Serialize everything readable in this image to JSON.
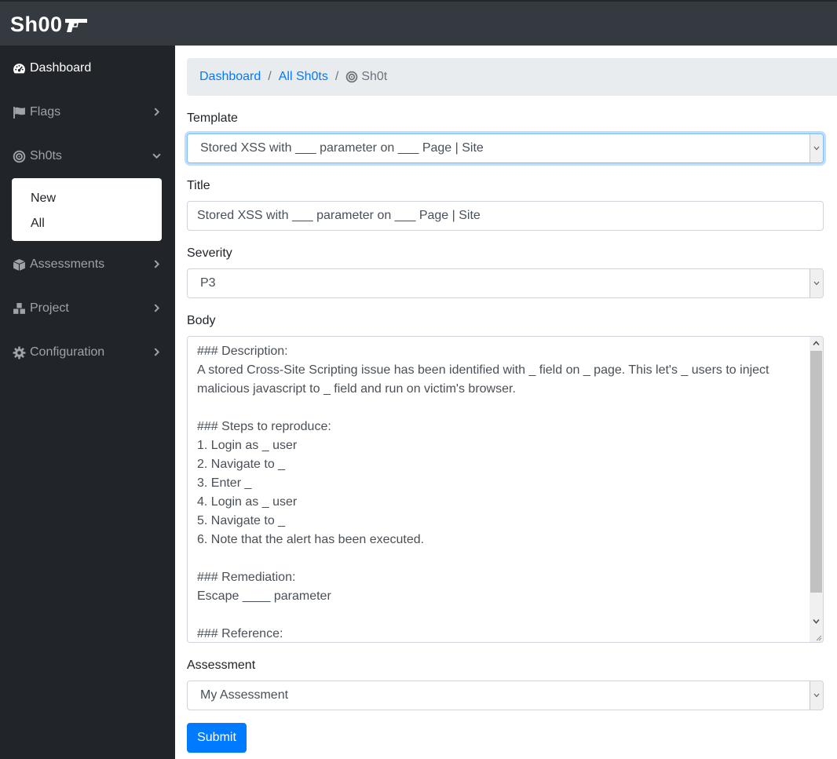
{
  "brand": {
    "name": "Sh00",
    "logo_icon": "gun-icon"
  },
  "sidebar": {
    "items": [
      {
        "label": "Dashboard",
        "icon": "tachometer-icon",
        "active": true
      },
      {
        "label": "Flags",
        "icon": "flag-icon",
        "chevron": "right"
      },
      {
        "label": "Sh0ts",
        "icon": "bullseye-icon",
        "chevron": "down"
      },
      {
        "label": "Assessments",
        "icon": "cube-icon",
        "chevron": "right"
      },
      {
        "label": "Project",
        "icon": "cubes-icon",
        "chevron": "right"
      },
      {
        "label": "Configuration",
        "icon": "gear-icon",
        "chevron": "right"
      }
    ],
    "submenu": [
      {
        "label": "New"
      },
      {
        "label": "All"
      }
    ]
  },
  "breadcrumb": {
    "items": [
      {
        "label": "Dashboard"
      },
      {
        "label": "All Sh0ts"
      }
    ],
    "separator": "/",
    "current": "Sh0t"
  },
  "form": {
    "template": {
      "label": "Template",
      "value": "Stored XSS with ___ parameter on ___ Page | Site"
    },
    "title": {
      "label": "Title",
      "value": "Stored XSS with ___ parameter on ___ Page | Site"
    },
    "severity": {
      "label": "Severity",
      "value": "P3"
    },
    "body": {
      "label": "Body",
      "value": "### Description:\nA stored Cross-Site Scripting issue has been identified with _ field on _ page. This let's _ users to inject malicious javascript to _ field and run on victim's browser.\n\n### Steps to reproduce:\n1. Login as _ user\n2. Navigate to _\n3. Enter _\n4. Login as _ user\n5. Navigate to _\n6. Note that the alert has been executed.\n\n### Remediation:\nEscape ____ parameter\n\n### Reference:"
    },
    "assessment": {
      "label": "Assessment",
      "value": "My Assessment"
    },
    "submit_label": "Submit"
  },
  "colors": {
    "topbar": "#343a40",
    "sidebar": "#212529",
    "primary": "#007bff",
    "breadcrumb_bg": "#e9ecef"
  }
}
